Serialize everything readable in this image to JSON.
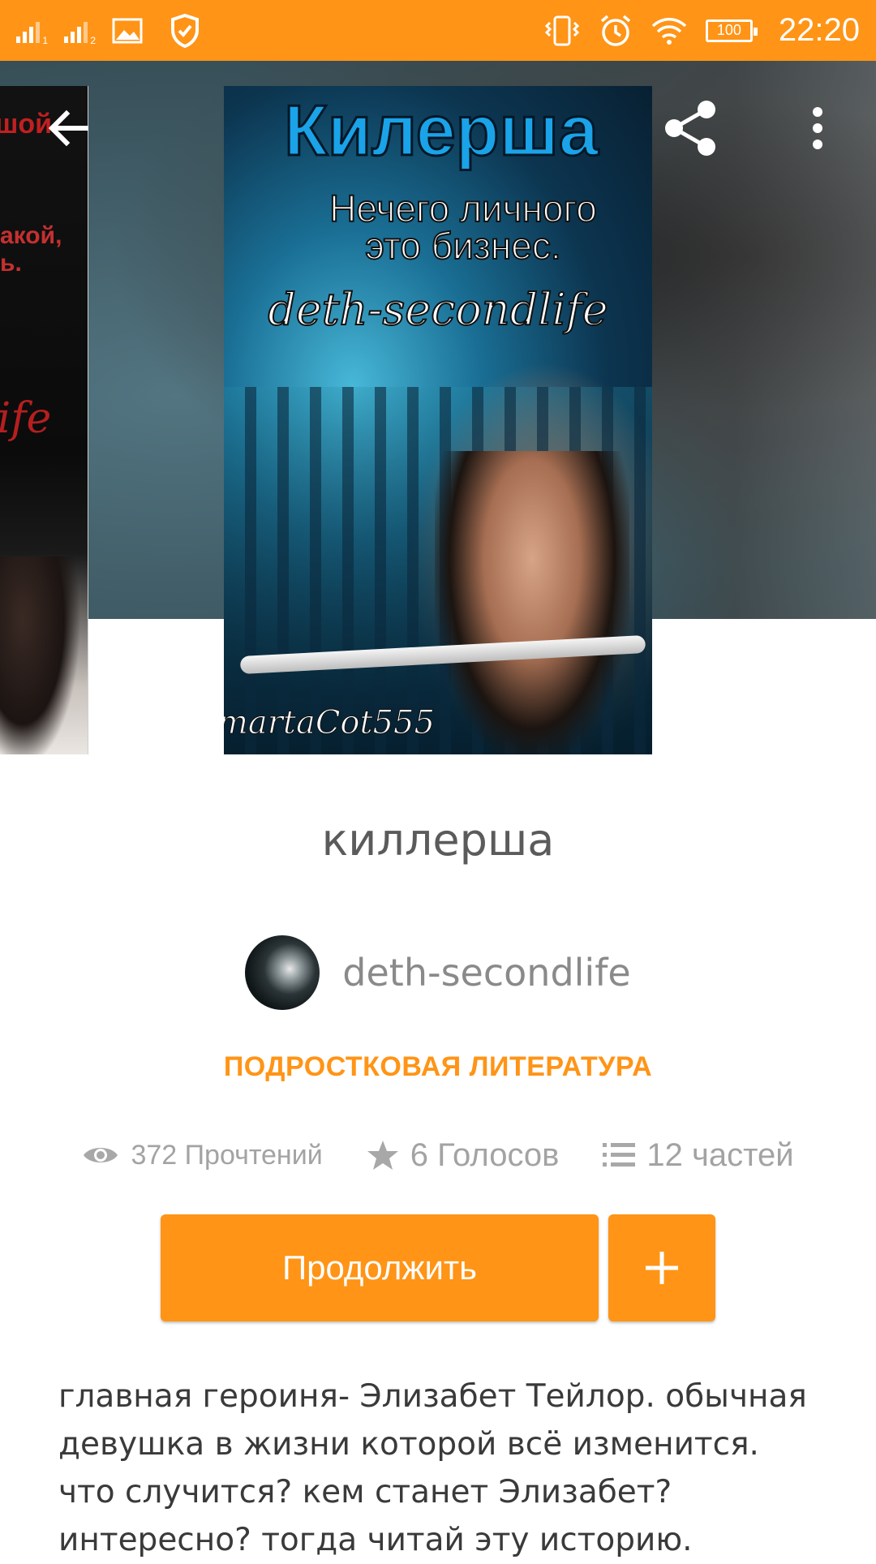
{
  "status_bar": {
    "time": "22:20",
    "battery": "100",
    "sim1": "1",
    "sim2": "2",
    "icons": [
      "signal-icon",
      "gallery-icon",
      "shield-check-icon",
      "vibrate-icon",
      "alarm-icon",
      "wifi-icon",
      "battery-icon"
    ]
  },
  "toolbar": {
    "icons": [
      "arrow-back-icon",
      "share-icon",
      "more-vert-icon"
    ]
  },
  "cover": {
    "title": "Килерша",
    "subtitle_line1": "Нечего личного",
    "subtitle_line2": "это бизнес.",
    "author": "deth-secondlife",
    "artist": "martaCot555"
  },
  "side_cover": {
    "text1": "шой",
    "text2_line1": "акой,",
    "text2_line2": "ь.",
    "text3": "life"
  },
  "story": {
    "title": "киллерша",
    "author": "deth-secondlife",
    "genre": "ПОДРОСТКОВАЯ ЛИТЕРАТУРА",
    "reads": "372 Прочтений",
    "votes": "6 Голосов",
    "parts": "12 частей",
    "description": "главная героиня- Элизабет Тейлор. обычная девушка в жизни которой всё изменится. что случится? кем станет Элизабет? интересно? тогда читай эту историю."
  },
  "actions": {
    "continue_label": "Продолжить",
    "add_label": "+"
  },
  "colors": {
    "accent": "#ff9416",
    "text_dark": "#3a3a3a",
    "text_muted": "#9b9b9b"
  }
}
